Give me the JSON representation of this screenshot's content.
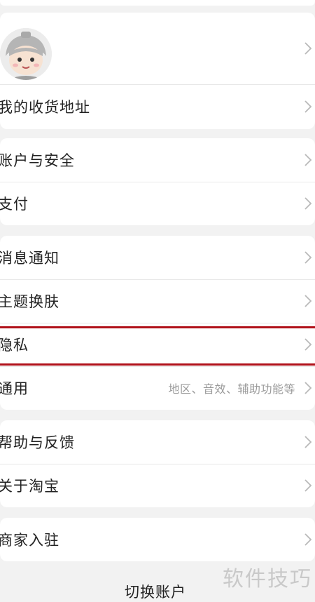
{
  "profile": {
    "avatar_alt": "avatar"
  },
  "groups": [
    {
      "items": [
        {
          "id": "address",
          "label": "我的收货地址"
        }
      ]
    },
    {
      "items": [
        {
          "id": "account-security",
          "label": "账户与安全"
        },
        {
          "id": "payment",
          "label": "支付"
        }
      ]
    },
    {
      "items": [
        {
          "id": "notifications",
          "label": "消息通知"
        },
        {
          "id": "theme",
          "label": "主题换肤"
        },
        {
          "id": "privacy",
          "label": "隐私"
        },
        {
          "id": "general",
          "label": "通用",
          "sub": "地区、音效、辅助功能等"
        }
      ]
    },
    {
      "items": [
        {
          "id": "help",
          "label": "帮助与反馈"
        },
        {
          "id": "about",
          "label": "关于淘宝"
        }
      ]
    },
    {
      "items": [
        {
          "id": "merchant",
          "label": "商家入驻"
        }
      ]
    }
  ],
  "footer": {
    "switch_account": "切换账户"
  },
  "watermark": "软件技巧",
  "colors": {
    "highlight": "#b0111a",
    "background": "#f2f2f2",
    "card": "#ffffff"
  }
}
